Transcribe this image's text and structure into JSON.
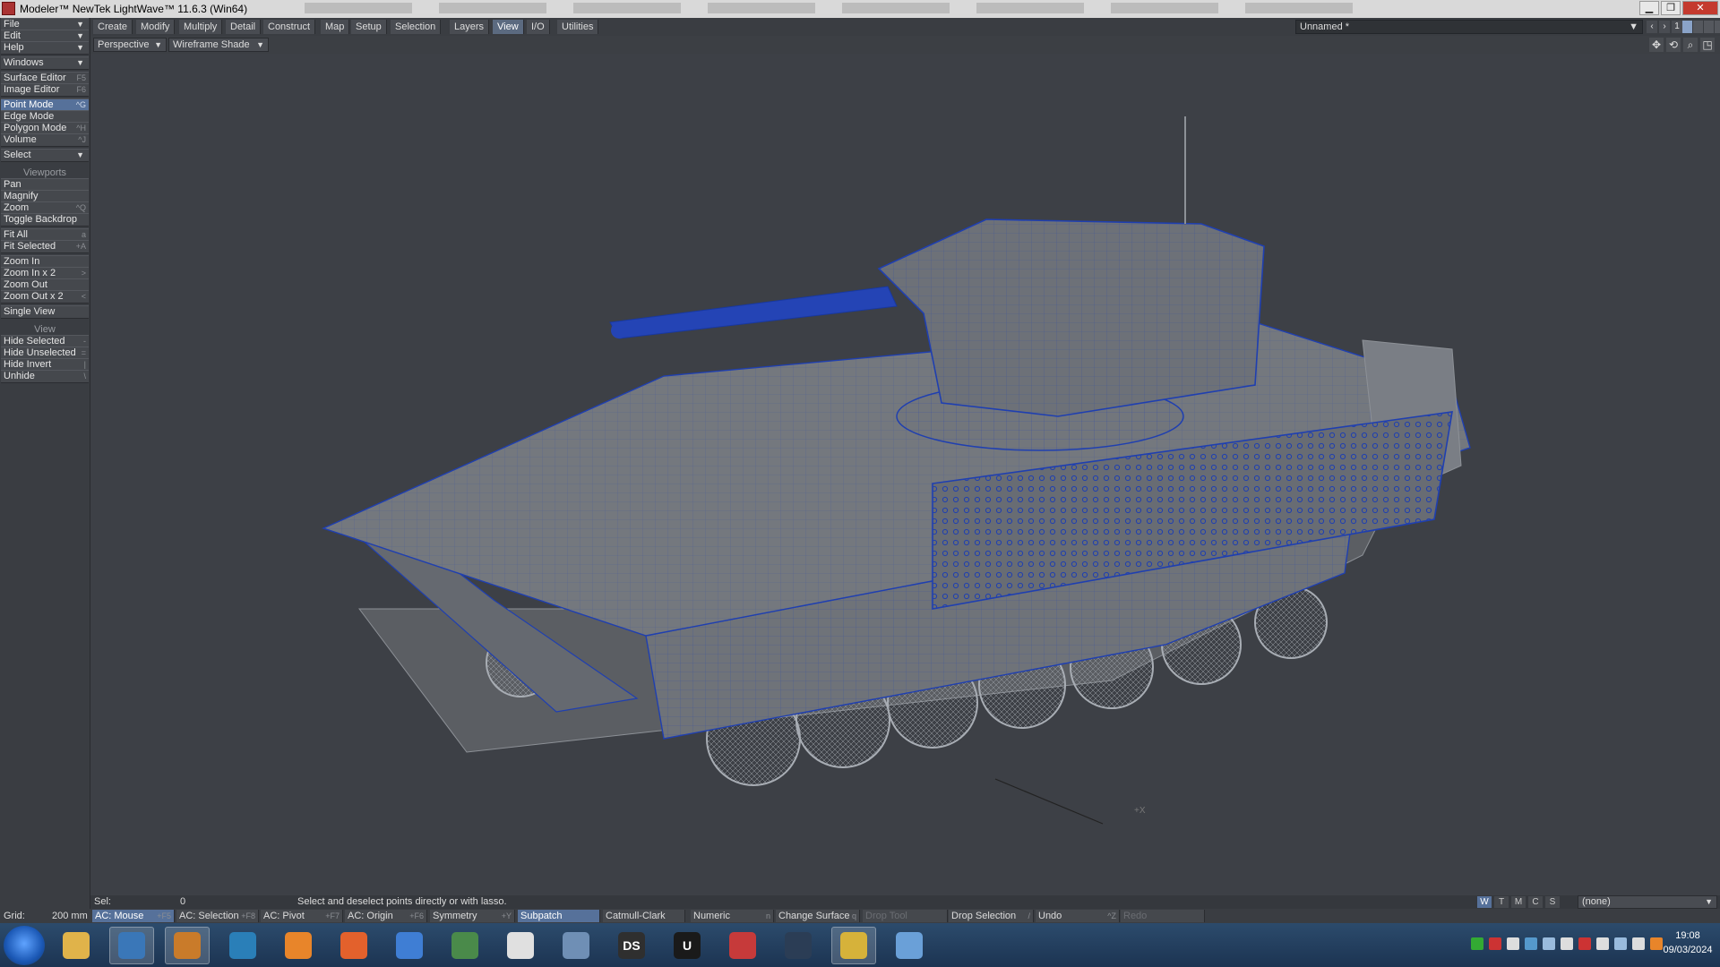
{
  "window": {
    "title": "Modeler™ NewTek LightWave™ 11.6.3 (Win64)",
    "buttons": {
      "minimize": "▁",
      "maximize": "❐",
      "close": "✕"
    }
  },
  "tabs": [
    {
      "label": "Create",
      "active": false
    },
    {
      "label": "Modify",
      "active": false
    },
    {
      "label": "Multiply",
      "active": false
    },
    {
      "label": "Detail",
      "active": false
    },
    {
      "label": "Construct",
      "active": false
    },
    {
      "label": "Map",
      "active": false
    },
    {
      "label": "Setup",
      "active": false
    },
    {
      "label": "Selection",
      "active": false
    },
    {
      "label": "Layers",
      "active": false
    },
    {
      "label": "View",
      "active": true
    },
    {
      "label": "I/O",
      "active": false
    },
    {
      "label": "Utilities",
      "active": false
    }
  ],
  "scene": {
    "name": "Unnamed *",
    "layer_number": "1"
  },
  "viewport": {
    "projection": "Perspective",
    "shading": "Wireframe Shade",
    "axis_label": "+X"
  },
  "sidebar": {
    "menus": {
      "file": "File",
      "edit": "Edit",
      "help": "Help",
      "windows": "Windows"
    },
    "editors": [
      {
        "label": "Surface Editor",
        "key": "F5"
      },
      {
        "label": "Image Editor",
        "key": "F6"
      }
    ],
    "modes": [
      {
        "label": "Point Mode",
        "key": "^G",
        "active": true
      },
      {
        "label": "Edge Mode",
        "key": "",
        "active": false
      },
      {
        "label": "Polygon Mode",
        "key": "^H",
        "active": false
      },
      {
        "label": "Volume",
        "key": "^J",
        "active": false
      }
    ],
    "select": "Select",
    "viewports_header": "Viewports",
    "viewport_tools": [
      {
        "label": "Pan",
        "key": ""
      },
      {
        "label": "Magnify",
        "key": ""
      },
      {
        "label": "Zoom",
        "key": "^Q"
      },
      {
        "label": "Toggle Backdrop",
        "key": ""
      }
    ],
    "fit_tools": [
      {
        "label": "Fit All",
        "key": "a"
      },
      {
        "label": "Fit Selected",
        "key": "+A"
      }
    ],
    "zoom_tools": [
      {
        "label": "Zoom In",
        "key": ""
      },
      {
        "label": "Zoom In x 2",
        "key": ">"
      },
      {
        "label": "Zoom Out",
        "key": ""
      },
      {
        "label": "Zoom Out x 2",
        "key": "<"
      }
    ],
    "single_view": "Single View",
    "view_header": "View",
    "view_tools": [
      {
        "label": "Hide Selected",
        "key": "-"
      },
      {
        "label": "Hide Unselected",
        "key": "="
      },
      {
        "label": "Hide Invert",
        "key": "|"
      },
      {
        "label": "Unhide",
        "key": "\\"
      }
    ]
  },
  "status": {
    "sel_label": "Sel:",
    "sel_count": "0",
    "hint": "Select and deselect points directly or with lasso."
  },
  "bottom": {
    "grid_label": "Grid:",
    "grid_value": "200 mm",
    "buttons": [
      {
        "label": "AC: Mouse",
        "key": "+F5",
        "highlight": true,
        "dim": false
      },
      {
        "label": "AC: Selection",
        "key": "+F8",
        "highlight": false,
        "dim": false
      },
      {
        "label": "AC: Pivot",
        "key": "+F7",
        "highlight": false,
        "dim": false
      },
      {
        "label": "AC: Origin",
        "key": "+F6",
        "highlight": false,
        "dim": false
      },
      {
        "label": "Symmetry",
        "key": "+Y",
        "highlight": false,
        "dim": false
      },
      {
        "label": "Subpatch",
        "key": "",
        "highlight": true,
        "dim": false
      },
      {
        "label": "Catmull-Clark",
        "key": "",
        "highlight": false,
        "dim": false
      },
      {
        "label": "Numeric",
        "key": "n",
        "highlight": false,
        "dim": false
      },
      {
        "label": "Change Surface",
        "key": "q",
        "highlight": false,
        "dim": false
      },
      {
        "label": "Drop Tool",
        "key": "",
        "highlight": false,
        "dim": true
      },
      {
        "label": "Drop Selection",
        "key": "/",
        "highlight": false,
        "dim": false
      },
      {
        "label": "Undo",
        "key": "^Z",
        "highlight": false,
        "dim": false
      },
      {
        "label": "Redo",
        "key": "",
        "highlight": false,
        "dim": true
      }
    ],
    "wtmcs": [
      "W",
      "T",
      "M",
      "C",
      "S"
    ],
    "surface_dropdown": "(none)"
  },
  "taskbar": {
    "items": [
      {
        "icon": "file-explorer-icon",
        "label": "",
        "color": "#e0b34a",
        "active": false
      },
      {
        "icon": "image-viewer-icon",
        "label": "",
        "color": "#3a77b8",
        "active": true
      },
      {
        "icon": "lightwave-modeler-icon",
        "label": "",
        "color": "#c97b2a",
        "active": true
      },
      {
        "icon": "refresh-tool-icon",
        "label": "",
        "color": "#2a7fb8",
        "active": false
      },
      {
        "icon": "blender-icon",
        "label": "",
        "color": "#e8852a",
        "active": false
      },
      {
        "icon": "firefox-icon",
        "label": "",
        "color": "#e3612c",
        "active": false
      },
      {
        "icon": "thunderbird-icon",
        "label": "",
        "color": "#3f7ed4",
        "active": false
      },
      {
        "icon": "presentation-icon",
        "label": "",
        "color": "#4a8a4a",
        "active": false
      },
      {
        "icon": "text-editor-icon",
        "label": "",
        "color": "#e0e0e0",
        "active": false
      },
      {
        "icon": "calculator-icon",
        "label": "",
        "color": "#6f8fb5",
        "active": false
      },
      {
        "icon": "daz-studio-icon",
        "label": "DS",
        "color": "#2f2f2f",
        "active": false
      },
      {
        "icon": "unreal-icon",
        "label": "U",
        "color": "#1a1a1a",
        "active": false
      },
      {
        "icon": "anatomy-icon",
        "label": "",
        "color": "#c63a3a",
        "active": false
      },
      {
        "icon": "affinity-icon",
        "label": "",
        "color": "#2b3d55",
        "active": false
      },
      {
        "icon": "chrome-icon",
        "label": "",
        "color": "#d6b23a",
        "active": true
      },
      {
        "icon": "terminal-icon",
        "label": "",
        "color": "#6aa0d8",
        "active": false
      }
    ],
    "tray": [
      "#3a3",
      "#c33",
      "#ddd",
      "#59c",
      "#9bd",
      "#ddd",
      "#c33",
      "#ddd",
      "#9bd",
      "#ddd",
      "#e8852a"
    ],
    "time": "19:08",
    "date": "09/03/2024"
  }
}
